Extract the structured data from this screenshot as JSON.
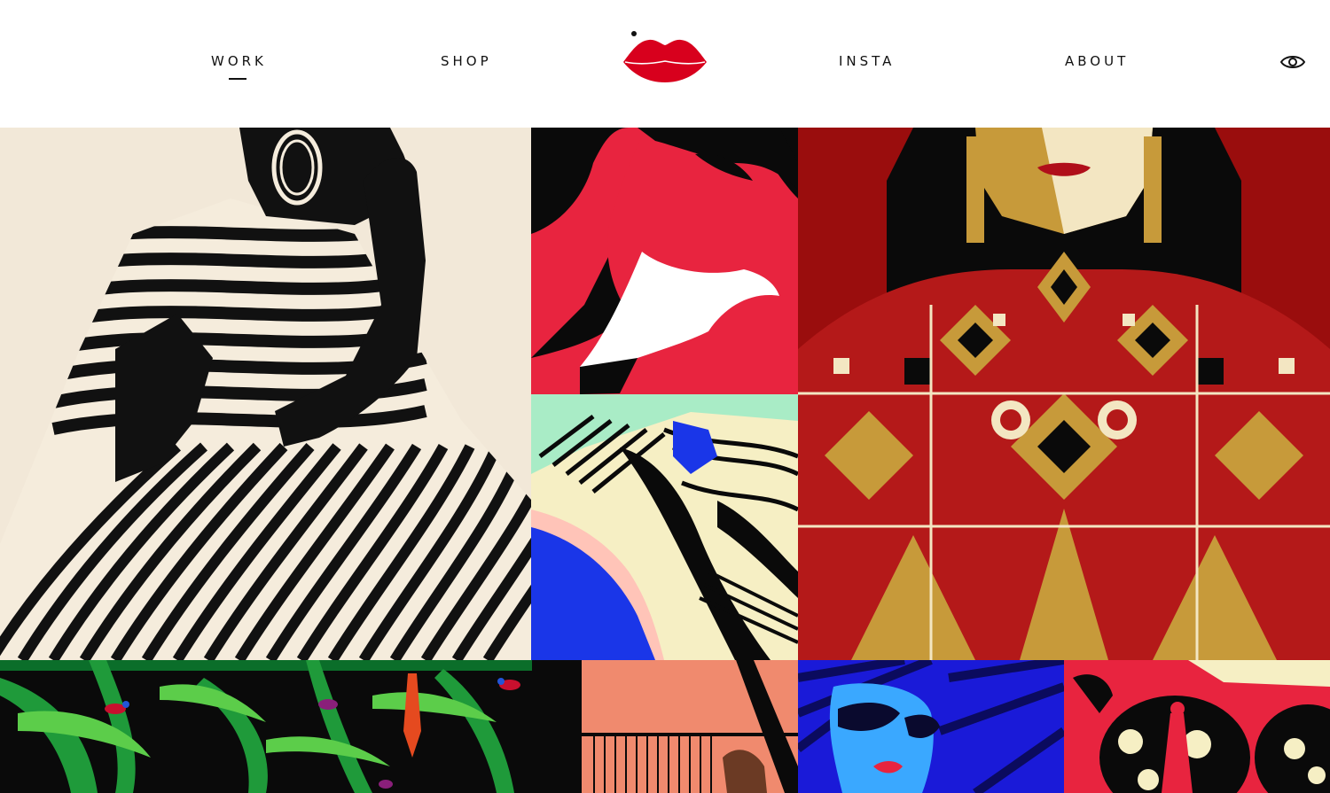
{
  "nav": {
    "work_label": "WORK",
    "shop_label": "SHOP",
    "insta_label": "INSTA",
    "about_label": "ABOUT",
    "active_item": "WORK"
  },
  "colors": {
    "brand_red": "#d8001d",
    "text": "#111111",
    "background": "#ffffff"
  },
  "icons": {
    "logo": "red-lips-logo",
    "view_toggle": "eye-icon"
  },
  "gallery": [
    {
      "name": "striped-dress-woman-artwork"
    },
    {
      "name": "kissing-couple-red-artwork"
    },
    {
      "name": "abstract-fabric-folds-artwork"
    },
    {
      "name": "ornate-red-gold-woman-artwork"
    },
    {
      "name": "tropical-leaves-birds-artwork"
    },
    {
      "name": "peach-building-artwork"
    },
    {
      "name": "blue-sunglasses-woman-artwork"
    },
    {
      "name": "red-glasses-reflection-artwork"
    }
  ]
}
